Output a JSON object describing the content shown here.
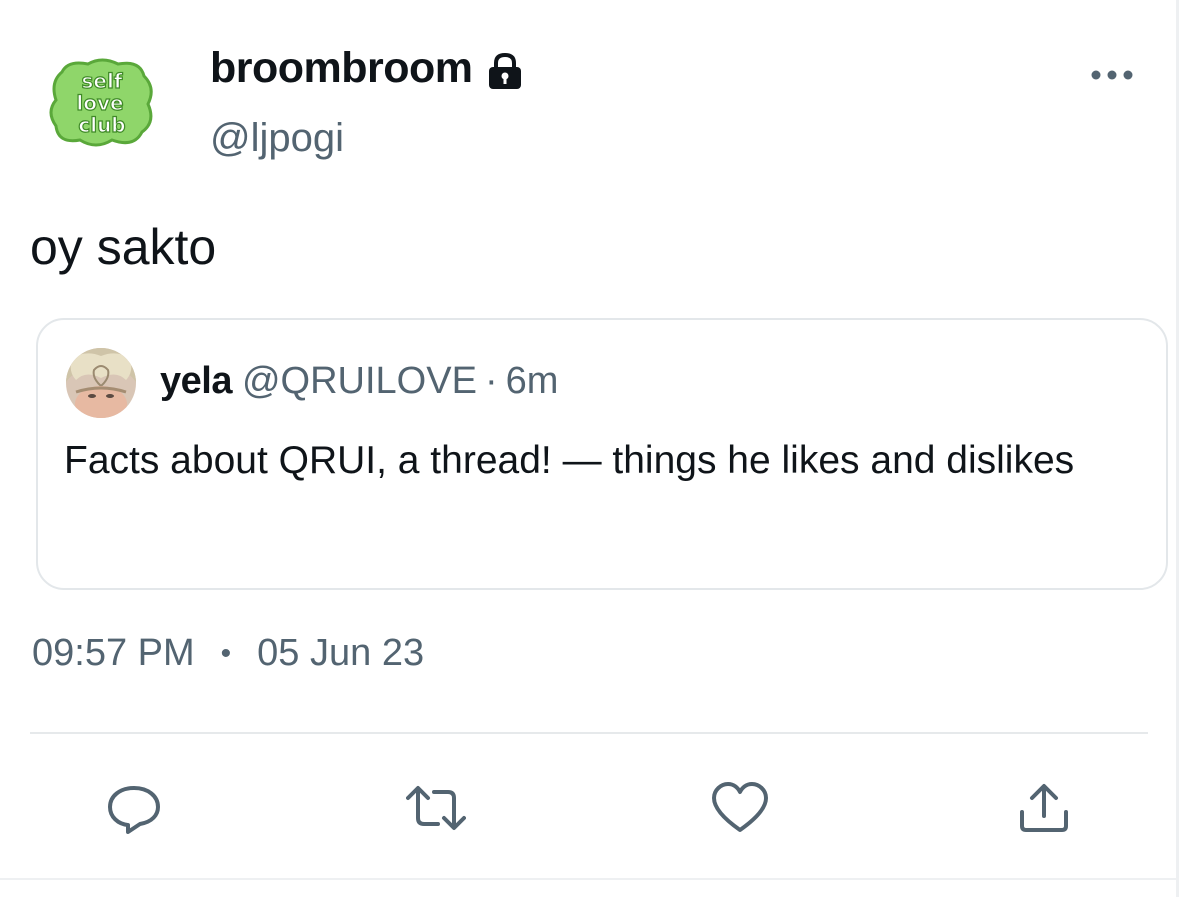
{
  "author": {
    "display_name": "broombroom",
    "handle": "@ljpogi",
    "avatar_text": [
      "self",
      "love",
      "club"
    ]
  },
  "tweet": {
    "text": "oy sakto"
  },
  "quoted_tweet": {
    "display_name": "yela",
    "handle": "@QRUILOVE",
    "separator": "·",
    "time": "6m",
    "text": "Facts about QRUI, a thread! — things he likes and dislikes"
  },
  "meta": {
    "time": "09:57 PM",
    "separator": "•",
    "date": "05 Jun 23"
  },
  "actions": {
    "reply_icon": "speech-bubble-icon",
    "retweet_icon": "retweet-arrows-icon",
    "like_icon": "heart-icon",
    "share_icon": "share-upload-icon"
  },
  "colors": {
    "text_primary": "#0f1419",
    "text_secondary": "#536471",
    "border": "#e3e7ea",
    "avatar_green": "#8fd66a",
    "avatar_green_dark": "#5aa83a"
  }
}
